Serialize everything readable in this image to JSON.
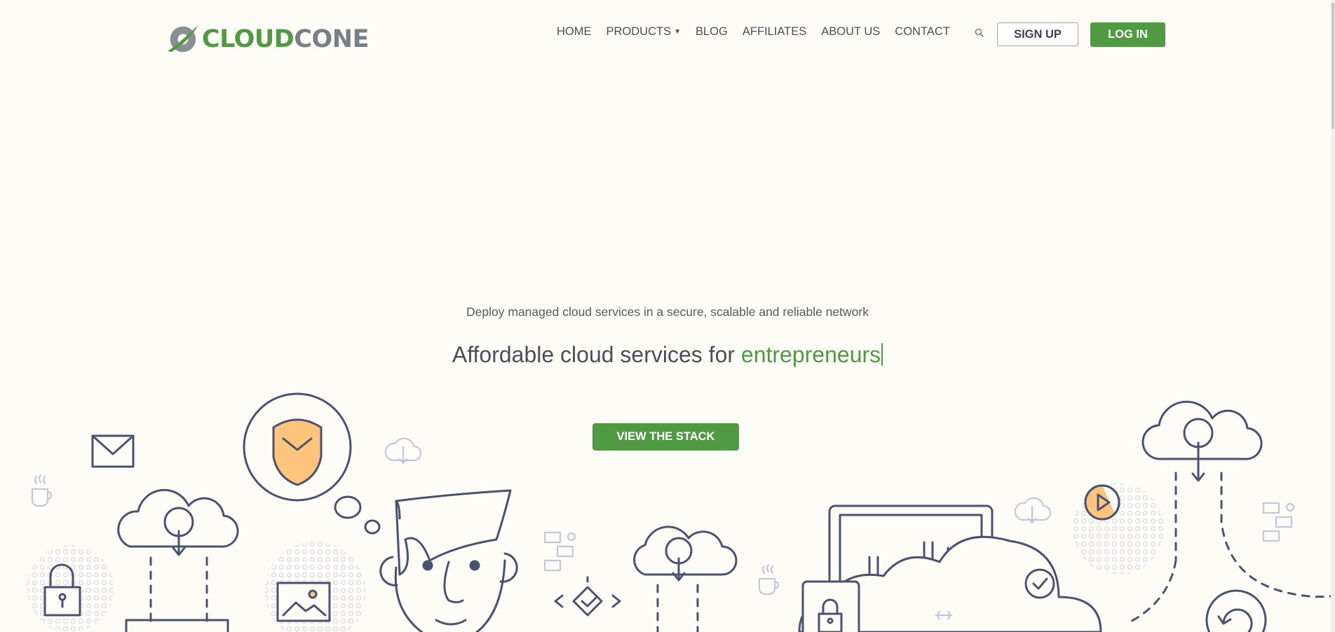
{
  "logo": {
    "part1": "CLOUD",
    "part2": "CONE"
  },
  "nav": {
    "items": [
      {
        "label": "HOME",
        "has_dropdown": false
      },
      {
        "label": "PRODUCTS",
        "has_dropdown": true
      },
      {
        "label": "BLOG",
        "has_dropdown": false
      },
      {
        "label": "AFFILIATES",
        "has_dropdown": false
      },
      {
        "label": "ABOUT US",
        "has_dropdown": false
      },
      {
        "label": "CONTACT",
        "has_dropdown": false
      }
    ],
    "search_icon": "search-icon",
    "signup_label": "SIGN UP",
    "login_label": "LOG IN"
  },
  "hero": {
    "tagline": "Deploy managed cloud services in a secure, scalable and reliable network",
    "headline_prefix": "Affordable cloud services for ",
    "headline_accent": "entrepreneurs",
    "cta_label": "VIEW THE STACK"
  },
  "colors": {
    "brand_green": "#4f9a42",
    "background": "#fdfcf6",
    "illustration_stroke": "#4a5270",
    "illustration_accent": "#fdc57b"
  }
}
